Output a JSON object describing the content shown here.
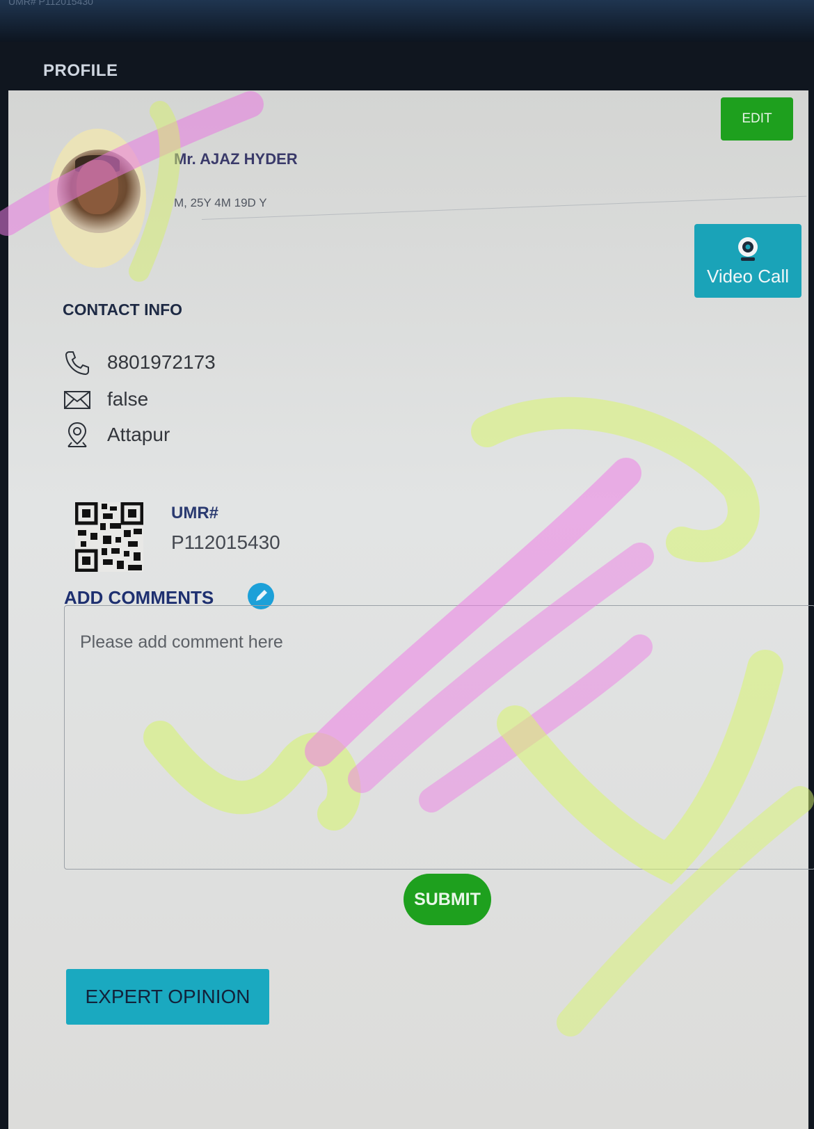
{
  "top_strip_text": "UMR# P112015430",
  "header": {
    "title": "PROFILE"
  },
  "profile": {
    "name": "Mr. AJAZ HYDER",
    "details": "M, 25Y 4M 19D Y",
    "avatar_icon": "user-photo"
  },
  "actions": {
    "edit_label": "EDIT",
    "video_call_label": "Video Call",
    "video_call_icon": "webcam-icon"
  },
  "contact": {
    "title": "CONTACT INFO",
    "phone": "8801972173",
    "email": "false",
    "location": "Attapur"
  },
  "umr": {
    "label": "UMR#",
    "value": "P112015430",
    "qr_icon": "qr-code-icon"
  },
  "comments": {
    "title": "ADD COMMENTS",
    "placeholder": "Please add comment here",
    "submit_label": "SUBMIT"
  },
  "expert_opinion_label": "EXPERT OPINION",
  "colors": {
    "green_button": "#1ea01e",
    "teal_button": "#1aa3b8",
    "title_navy": "#1e2a44",
    "panel_bg": "#e0e1e0"
  }
}
